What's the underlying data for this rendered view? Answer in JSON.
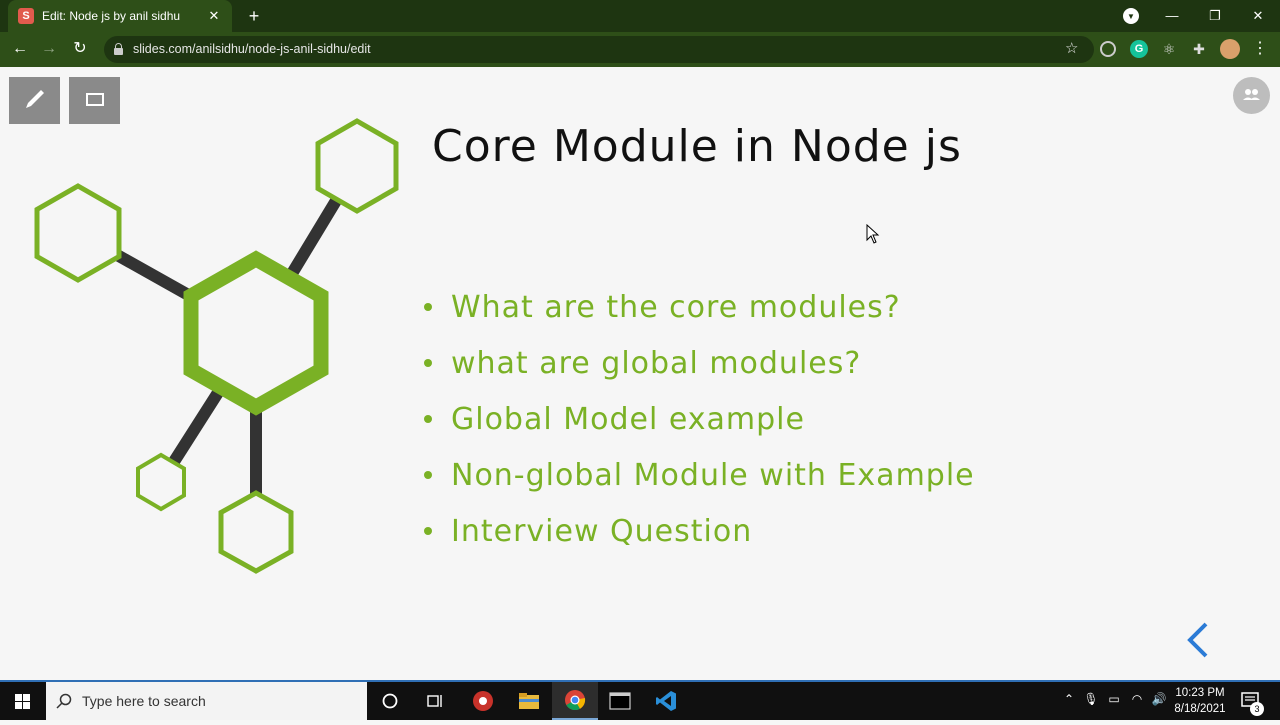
{
  "browser": {
    "tab_title": "Edit: Node js by anil sidhu",
    "tab_favicon": "S",
    "url": "slides.com/anilsidhu/node-js-anil-sidhu/edit"
  },
  "slide": {
    "title": "Core Module in Node js",
    "bullets": [
      "What are the core modules?",
      "what are global modules?",
      "Global Model example",
      "Non-global Module with Example",
      "Interview Question"
    ],
    "accent_color": "#7ab125"
  },
  "taskbar": {
    "search_placeholder": "Type here to search",
    "time": "10:23 PM",
    "date": "8/18/2021",
    "notification_count": "3"
  }
}
